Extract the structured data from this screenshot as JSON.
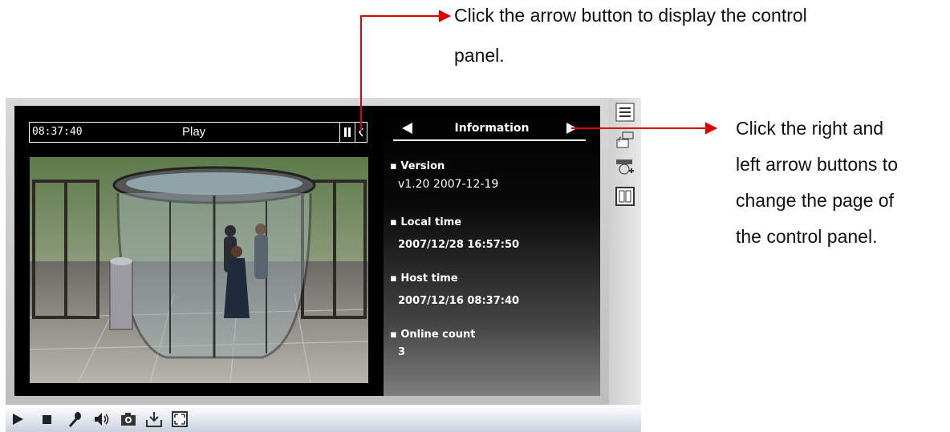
{
  "callouts": {
    "top_line1": "Click the arrow button to display the control",
    "top_line2": "panel.",
    "right_line1": "Click the right and",
    "right_line2": "left arrow buttons to",
    "right_line3": "change the page of",
    "right_line4": "the control panel."
  },
  "viewer": {
    "timestamp": "08:37:40",
    "status": "Play"
  },
  "panel": {
    "title": "Information",
    "items": [
      {
        "label": "Version",
        "value": "v1.20  2007-12-19"
      },
      {
        "label": "Local time",
        "value": "2007/12/28 16:57:50"
      },
      {
        "label": "Host time",
        "value": "2007/12/16 08:37:40"
      },
      {
        "label": "Online count",
        "value": "3"
      }
    ]
  },
  "colors": {
    "arrow": "#e00000",
    "panel_bg": "#000000",
    "text": "#ffffff"
  },
  "icons": {
    "toolbar": [
      "play-icon",
      "stop-icon",
      "microphone-icon",
      "speaker-icon",
      "snapshot-icon",
      "record-icon",
      "fullscreen-icon"
    ],
    "side": [
      "control-panel-icon",
      "dome-camera-icon",
      "ptz-camera-icon",
      "digital-io-icon"
    ]
  }
}
